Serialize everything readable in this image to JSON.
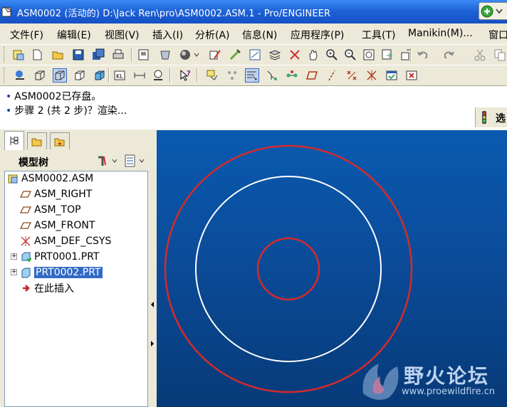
{
  "window": {
    "title": "ASM0002 (活动的) D:\\Jack Ren\\pro\\ASM0002.ASM.1 - Pro/ENGINEER"
  },
  "menu": {
    "items": [
      "文件(F)",
      "编辑(E)",
      "视图(V)",
      "插入(I)",
      "分析(A)",
      "信息(N)",
      "应用程序(P)",
      "工具(T)",
      "Manikin(M)...",
      "窗口"
    ]
  },
  "toolbar_row1_icons": [
    "new-window-icon",
    "new-file-icon",
    "open-folder-icon",
    "save-icon",
    "save-copy-icon",
    "print-icon",
    "print-preview-icon",
    "model-display-icon",
    "shading-sphere-icon",
    "sketch-tool-icon",
    "pen-tool-icon",
    "saved-views-icon",
    "layers-icon",
    "spin-orient-icon",
    "pan-hand-icon",
    "zoom-in-icon",
    "zoom-out-icon",
    "refit-icon",
    "redraw-icon",
    "orient-icon",
    "undo-icon",
    "redo-icon",
    "cut-icon",
    "copy-icon"
  ],
  "toolbar_row2_icons": [
    "datum-display-icon",
    "wireframe-icon",
    "hidden-line-icon",
    "no-hidden-icon",
    "shaded-cube-icon",
    "datum-planes-icon",
    "datum-axes-icon",
    "datum-points-icon",
    "whats-this-icon",
    "datum-plane-tool-icon",
    "datum-axis-tool-icon",
    "sketch-insert-icon",
    "datum-curve-icon",
    "datum-point-icon",
    "plane-toggle-icon",
    "axis-toggle-icon",
    "point-toggle-icon",
    "csys-toggle-icon",
    "select-window-icon",
    "close-window-icon"
  ],
  "messages": [
    "ASM0002已存盘。",
    "步骤 2 (共 2 步)？渲染..."
  ],
  "status_right": "选",
  "model_tree": {
    "header": "模型树",
    "items": [
      {
        "label": "ASM0002.ASM",
        "icon": "assembly-icon",
        "level": 0
      },
      {
        "label": "ASM_RIGHT",
        "icon": "datum-plane-icon",
        "level": 1
      },
      {
        "label": "ASM_TOP",
        "icon": "datum-plane-icon",
        "level": 1
      },
      {
        "label": "ASM_FRONT",
        "icon": "datum-plane-icon",
        "level": 1
      },
      {
        "label": "ASM_DEF_CSYS",
        "icon": "csys-icon",
        "level": 1
      },
      {
        "label": "PRT0001.PRT",
        "icon": "part-icon",
        "level": 1,
        "expandable": true
      },
      {
        "label": "PRT0002.PRT",
        "icon": "part-icon",
        "level": 1,
        "expandable": true,
        "selected": true
      },
      {
        "label": "在此插入",
        "icon": "insert-arrow-icon",
        "level": 1
      }
    ]
  },
  "viewport": {
    "circles": [
      {
        "role": "outer",
        "color": "#d62a2a"
      },
      {
        "role": "middle",
        "color": "#ffffff"
      },
      {
        "role": "inner",
        "color": "#d62a2a"
      }
    ]
  },
  "watermark": {
    "title": "野火论坛",
    "url": "www.proewildfire.cn"
  },
  "colors": {
    "titlebar": "#1f63d8",
    "viewport_top": "#0a5ab0",
    "viewport_bottom": "#073a78",
    "selection": "#316ac5"
  }
}
